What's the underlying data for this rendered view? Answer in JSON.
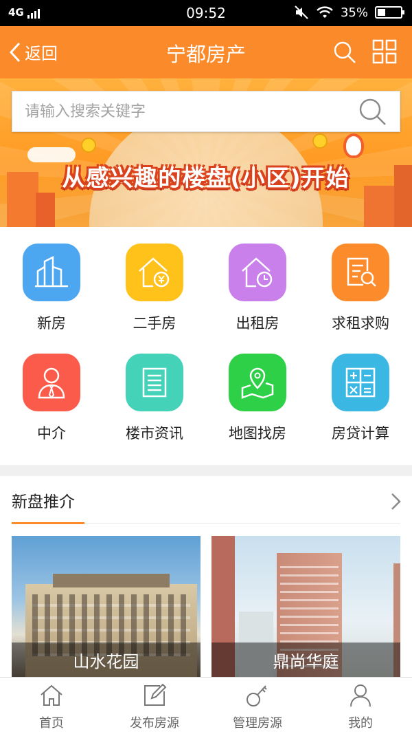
{
  "status_bar": {
    "network": "4G",
    "time": "09:52",
    "battery": "35%"
  },
  "header": {
    "back_label": "返回",
    "title": "宁都房产"
  },
  "banner": {
    "search_placeholder": "请输入搜索关键字",
    "slogan": "从感兴趣的楼盘(小区)开始"
  },
  "menu": [
    {
      "label": "新房",
      "icon": "buildings-icon",
      "color": "#4da6f0"
    },
    {
      "label": "二手房",
      "icon": "house-yen-icon",
      "color": "#ffc21a"
    },
    {
      "label": "出租房",
      "icon": "house-clock-icon",
      "color": "#c980ea"
    },
    {
      "label": "求租求购",
      "icon": "document-search-icon",
      "color": "#fb8b2b"
    },
    {
      "label": "中介",
      "icon": "agent-icon",
      "color": "#fb5b4b"
    },
    {
      "label": "楼市资讯",
      "icon": "news-icon",
      "color": "#44d3b9"
    },
    {
      "label": "地图找房",
      "icon": "map-pin-icon",
      "color": "#2ed047"
    },
    {
      "label": "房贷计算",
      "icon": "calculator-icon",
      "color": "#3ab8e3"
    }
  ],
  "new_listings": {
    "title": "新盘推介",
    "items": [
      {
        "name": "山水花园"
      },
      {
        "name": "鼎尚华庭"
      }
    ]
  },
  "tabbar": [
    {
      "label": "首页",
      "icon": "home-icon"
    },
    {
      "label": "发布房源",
      "icon": "edit-icon"
    },
    {
      "label": "管理房源",
      "icon": "key-icon"
    },
    {
      "label": "我的",
      "icon": "user-icon"
    }
  ],
  "colors": {
    "accent": "#fb8a2a"
  }
}
